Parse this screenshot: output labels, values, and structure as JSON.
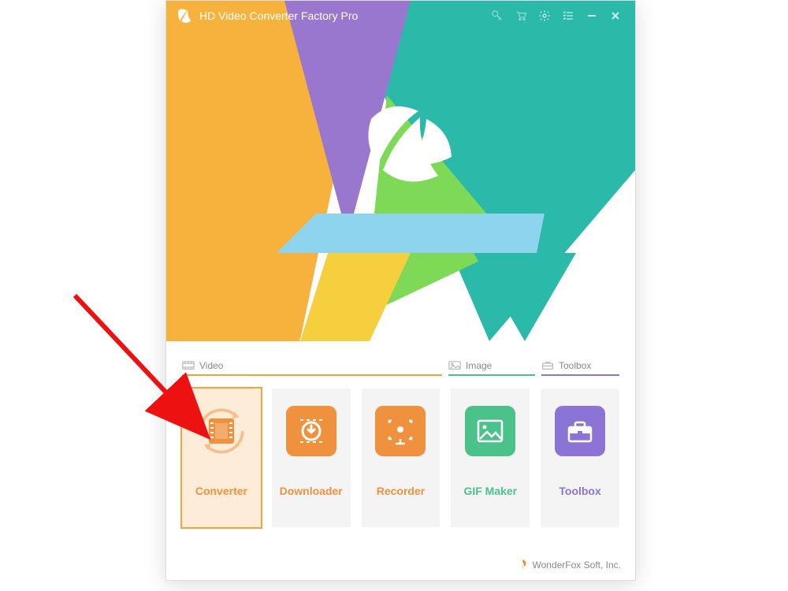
{
  "app": {
    "title": "HD Video Converter Factory Pro"
  },
  "categories": {
    "video": {
      "label": "Video"
    },
    "image": {
      "label": "Image"
    },
    "toolbox": {
      "label": "Toolbox"
    }
  },
  "tiles": {
    "converter": {
      "label": "Converter",
      "color": "orange",
      "selected": true
    },
    "downloader": {
      "label": "Downloader",
      "color": "orange",
      "selected": false
    },
    "recorder": {
      "label": "Recorder",
      "color": "orange",
      "selected": false
    },
    "gifmaker": {
      "label": "GIF Maker",
      "color": "green",
      "selected": false
    },
    "toolbox": {
      "label": "Toolbox",
      "color": "purple",
      "selected": false
    }
  },
  "footer": {
    "company": "WonderFox Soft, Inc."
  },
  "palette": {
    "orange": "#f0913e",
    "green": "#4ac28a",
    "purple": "#8b74d6",
    "teal": "#2bb9a9",
    "yellow": "#f8c24a",
    "violet": "#9a77cf",
    "lime": "#7ed957",
    "sky": "#6ec6f2"
  }
}
